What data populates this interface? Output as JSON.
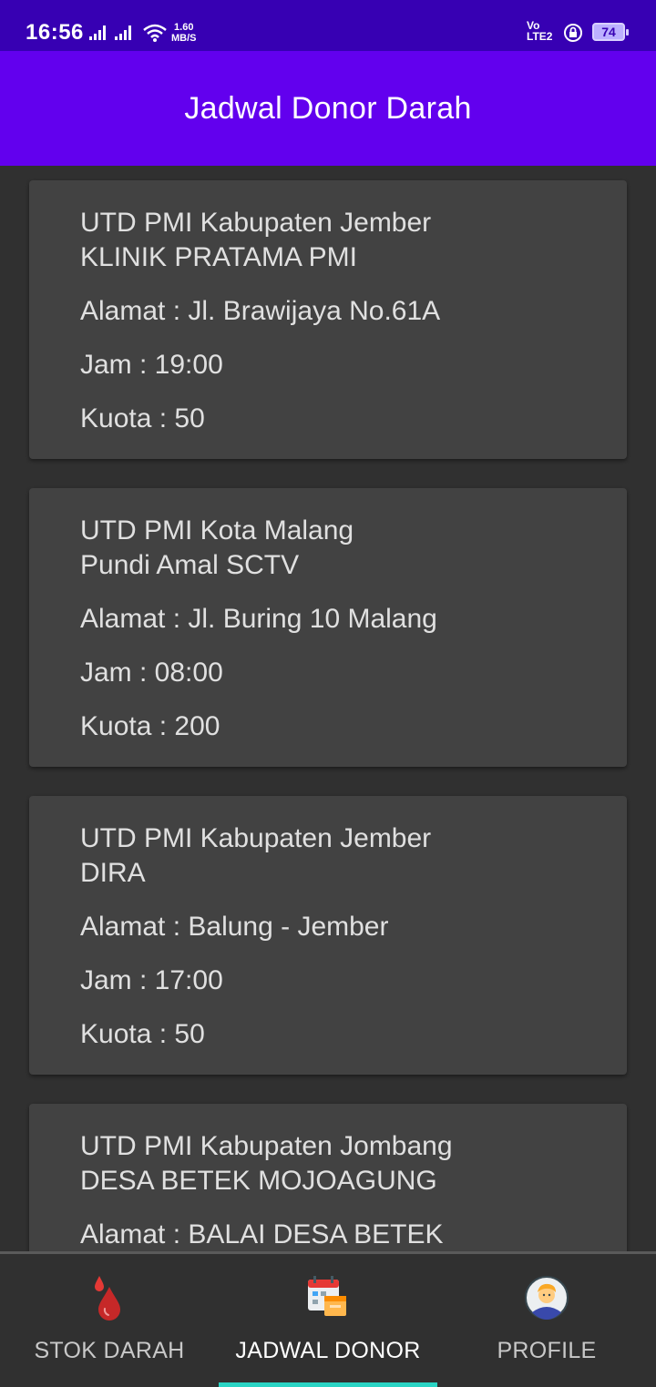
{
  "status_bar": {
    "time": "16:56",
    "net_speed_value": "1.60",
    "net_speed_unit": "MB/S",
    "volte_top": "Vo",
    "volte_bottom": "LTE2",
    "battery": "74"
  },
  "app_bar": {
    "title": "Jadwal Donor Darah"
  },
  "schedules": [
    {
      "unit": "UTD PMI Kabupaten Jember",
      "name": "KLINIK PRATAMA PMI",
      "address": "Alamat :  Jl. Brawijaya No.61A",
      "time": "Jam :  19:00",
      "quota": "Kuota :  50"
    },
    {
      "unit": "UTD PMI Kota Malang",
      "name": "Pundi Amal SCTV",
      "address": "Alamat :  Jl. Buring 10 Malang",
      "time": "Jam :  08:00",
      "quota": "Kuota :  200"
    },
    {
      "unit": "UTD PMI Kabupaten Jember",
      "name": "DIRA",
      "address": "Alamat :  Balung - Jember",
      "time": "Jam :  17:00",
      "quota": "Kuota :  50"
    },
    {
      "unit": "UTD PMI Kabupaten Jombang",
      "name": "DESA BETEK MOJOAGUNG",
      "address": "Alamat :  BALAI DESA BETEK",
      "time": "",
      "quota": ""
    }
  ],
  "bottom_nav": {
    "items": [
      {
        "label": "STOK DARAH",
        "icon": "blood-drop-icon",
        "active": false
      },
      {
        "label": "JADWAL DONOR",
        "icon": "calendar-schedule-icon",
        "active": true
      },
      {
        "label": "PROFILE",
        "icon": "user-avatar-icon",
        "active": false
      }
    ]
  },
  "colors": {
    "status_bar": "#3700b3",
    "app_bar": "#6200ee",
    "background": "#303030",
    "card": "#424242",
    "nav_indicator": "#2ad4c4"
  }
}
